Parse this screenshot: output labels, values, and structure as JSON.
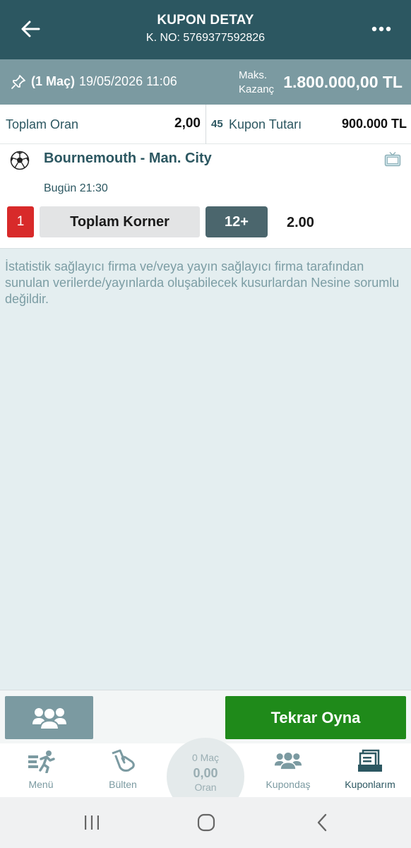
{
  "header": {
    "title": "KUPON DETAY",
    "subtitle": "K. NO: 5769377592826"
  },
  "infobar": {
    "mac_count": "(1 Maç)",
    "datetime": "19/05/2026 11:06",
    "maks_label_1": "Maks.",
    "maks_label_2": "Kazanç",
    "maks_value": "1.800.000,00 TL"
  },
  "totals": {
    "toplam_oran_label": "Toplam Oran",
    "toplam_oran_value": "2,00",
    "multiplier": "45",
    "kupon_tutari_label": "Kupon Tutarı",
    "kupon_tutari_value": "900.000 TL"
  },
  "match": {
    "teams": "Bournemouth - Man. City",
    "time": "Bugün 21:30",
    "mbs": "1",
    "market": "Toplam Korner",
    "pick": "12+",
    "odd": "2.00"
  },
  "disclaimer": "İstatistik sağlayıcı firma ve/veya yayın sağlayıcı firma tarafından sunulan verilerde/yayınlarda oluşabilecek kusurlardan Nesine sorumlu değildir.",
  "actions": {
    "tekrar_oyna": "Tekrar Oyna"
  },
  "tabs": {
    "menu": "Menü",
    "bulten": "Bülten",
    "kupondas": "Kupondaş",
    "kuponlarim": "Kuponlarım"
  },
  "betslip": {
    "mac": "0 Maç",
    "oran_value": "0,00",
    "oran_label": "Oran"
  },
  "colors": {
    "header": "#2c5761",
    "infobar": "#7b9aa1",
    "green": "#1f8a1a",
    "red": "#d82a2a"
  },
  "icons": {
    "back": "arrow-left-icon",
    "more": "more-dots-icon",
    "pin": "pin-icon",
    "ball": "soccer-ball-icon",
    "tv": "tv-icon"
  }
}
